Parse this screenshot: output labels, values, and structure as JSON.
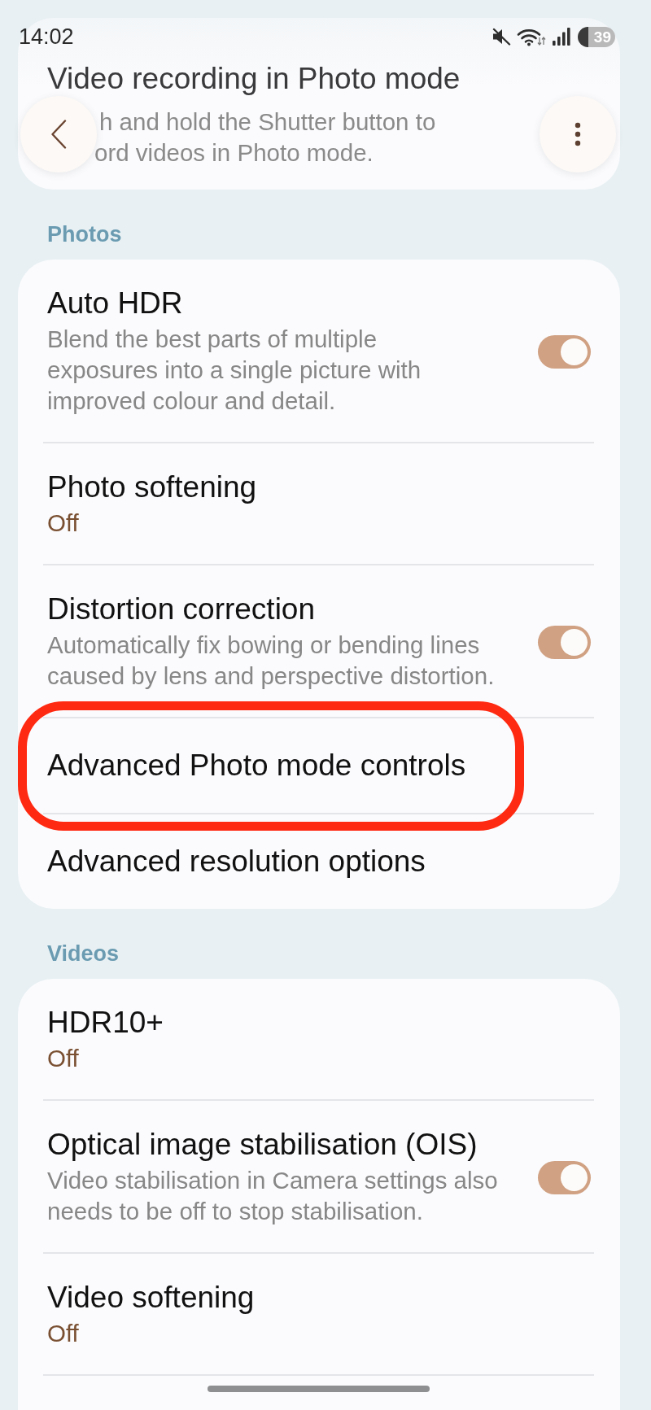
{
  "status_bar": {
    "time": "14:02",
    "battery": "39"
  },
  "scrolled_item": {
    "title": "Video recording in Photo mode",
    "summary_fragments": [
      "h and hold the Shutter button to",
      "ord videos in Photo mode."
    ]
  },
  "sections": [
    {
      "title": "Photos",
      "items": [
        {
          "kind": "switch",
          "title": "Auto HDR",
          "summary": "Blend the best parts of multiple\nexposures into a single picture with\nimproved colour and detail.",
          "on": true,
          "highlighted": false
        },
        {
          "kind": "value",
          "title": "Photo softening",
          "value": "Off",
          "highlighted": false
        },
        {
          "kind": "switch",
          "title": "Distortion correction",
          "summary": "Automatically fix bowing or bending lines\ncaused by lens and perspective distortion.",
          "on": true,
          "highlighted": false
        },
        {
          "kind": "link",
          "title": "Advanced Photo mode controls",
          "highlighted": true
        },
        {
          "kind": "link",
          "title": "Advanced resolution options",
          "highlighted": false
        }
      ]
    },
    {
      "title": "Videos",
      "items": [
        {
          "kind": "value",
          "title": "HDR10+",
          "value": "Off",
          "highlighted": false
        },
        {
          "kind": "switch",
          "title": "Optical image stabilisation (OIS)",
          "summary": "Video stabilisation in Camera settings also\nneeds to be off to stop stabilisation.",
          "on": true,
          "highlighted": false
        },
        {
          "kind": "value",
          "title": "Video softening",
          "value": "Off",
          "highlighted": false
        }
      ]
    }
  ]
}
